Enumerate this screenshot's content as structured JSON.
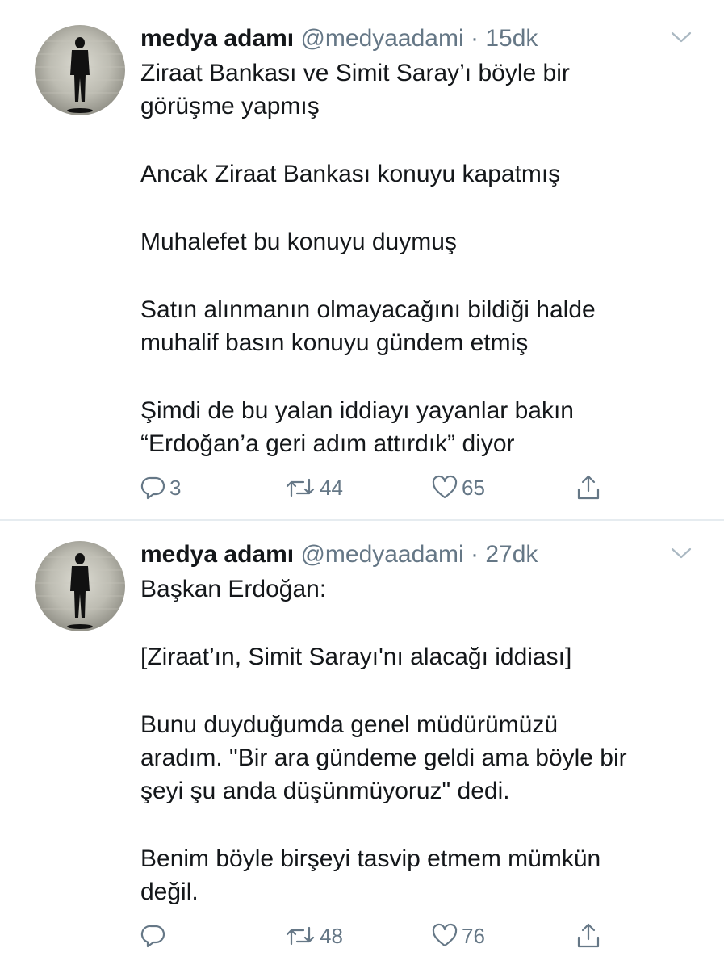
{
  "tweets": [
    {
      "name": "medya adamı",
      "handle": "@medyaadami",
      "separator": "·",
      "time": "15dk",
      "paragraphs": [
        "Ziraat Bankası ve Simit Saray’ı böyle bir\ngörüşme yapmış",
        "Ancak Ziraat Bankası konuyu kapatmış",
        "Muhalefet bu konuyu duymuş",
        "Satın alınmanın olmayacağını bildiği halde\nmuhalif basın konuyu gündem etmiş",
        "Şimdi de bu yalan iddiayı yayanlar bakın\n“Erdoğan’a geri adım attırdık” diyor"
      ],
      "replies": "3",
      "retweets": "44",
      "likes": "65"
    },
    {
      "name": "medya adamı",
      "handle": "@medyaadami",
      "separator": "·",
      "time": "27dk",
      "paragraphs": [
        "Başkan Erdoğan:",
        "[Ziraat’ın, Simit Sarayı'nı alacağı iddiası]",
        "Bunu duyduğumda genel müdürümüzü\naradım. \"Bir ara gündeme geldi ama böyle bir\nşeyi şu anda düşünmüyoruz\" dedi.",
        "Benim böyle birşeyi tasvip etmem mümkün\ndeğil."
      ],
      "replies": "",
      "retweets": "48",
      "likes": "76"
    }
  ],
  "icons": {
    "reply": "reply-icon",
    "retweet": "retweet-icon",
    "like": "heart-icon",
    "share": "share-icon",
    "more": "chevron-down-icon"
  },
  "colors": {
    "text": "#14171a",
    "secondary": "#657786",
    "divider": "#e6ecf0"
  }
}
